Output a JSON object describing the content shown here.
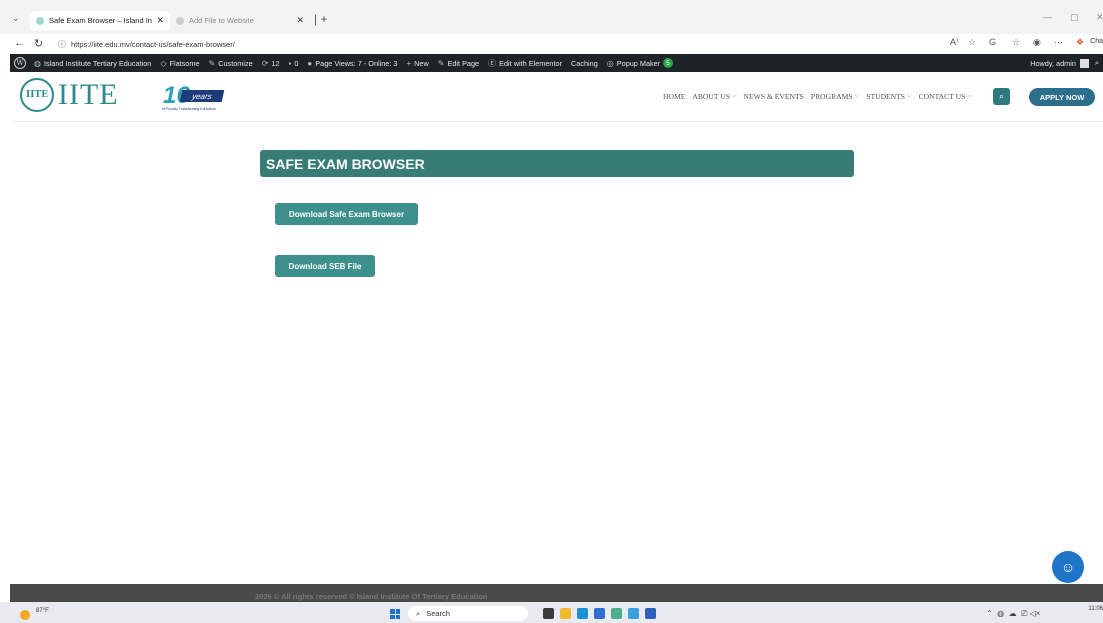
{
  "browser": {
    "tabs": [
      {
        "title": "Safe Exam Browser – Island Institu",
        "active": true
      },
      {
        "title": "Add File to Website",
        "active": false
      }
    ],
    "url": "https://iite.edu.mv/contact-us/safe-exam-browser/",
    "copilot_label": "Cha"
  },
  "wp_admin_bar": {
    "site_name": "Island Institute Tertiary Education",
    "theme": "Flatsome",
    "customize": "Customize",
    "updates": "12",
    "comments": "0",
    "page_views": "Page Views: 7 - Online: 3",
    "new": "New",
    "edit_page": "Edit Page",
    "elementor": "Edit with Elementor",
    "caching": "Caching",
    "popup_maker": "Popup Maker",
    "popup_count": "5",
    "howdy": "Howdy, admin"
  },
  "header": {
    "logo_text": "IITE",
    "seal_text": "IITE",
    "years_number": "16",
    "years_word": "years",
    "years_tagline": "of Proudly Transforming Education",
    "nav": [
      {
        "label": "HOME",
        "dropdown": false
      },
      {
        "label": "ABOUT US",
        "dropdown": true
      },
      {
        "label": "NEWS & EVENTS",
        "dropdown": false
      },
      {
        "label": "PROGRAMS",
        "dropdown": true
      },
      {
        "label": "STUDENTS",
        "dropdown": true
      },
      {
        "label": "CONTACT US",
        "dropdown": true
      }
    ],
    "apply_label": "APPLY NOW"
  },
  "content": {
    "title": "SAFE EXAM BROWSER",
    "download_seb": "Download Safe Exam Browser",
    "download_file": "Download SEB File"
  },
  "footer": {
    "copyright": "2026 © All rights reserved © Island Institute Of Tertiary Education"
  },
  "taskbar": {
    "weather_temp": "87°F",
    "search_label": "Search",
    "clock_time": "11:06"
  },
  "colors": {
    "teal_bar": "#377d75",
    "button": "#3d908c",
    "apply": "#2c6f8c",
    "wpbar": "#1d2327"
  }
}
